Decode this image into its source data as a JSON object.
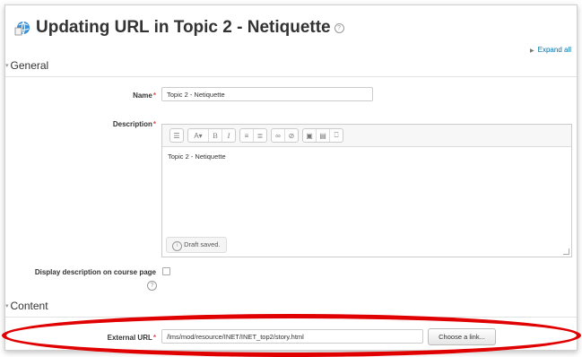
{
  "page": {
    "title": "Updating URL in Topic 2 - Netiquette",
    "expand_all": "Expand all"
  },
  "sections": {
    "general": "General",
    "content": "Content"
  },
  "form": {
    "name_label": "Name",
    "name_value": "Topic 2 - Netiquette",
    "description_label": "Description",
    "description_value": "Topic 2 - Netiquette",
    "draft_status": "Draft saved.",
    "display_description_label": "Display description on course page",
    "display_description_checked": false,
    "external_url_label": "External URL",
    "external_url_value": "/lms/mod/resource/INET/INET_top2/story.html",
    "choose_link_button": "Choose a link...",
    "required_marker": "*"
  },
  "toolbar": {
    "icons": [
      "format-icon",
      "font-style-icon",
      "bold-icon",
      "italic-icon",
      "unordered-list-icon",
      "ordered-list-icon",
      "link-icon",
      "unlink-icon",
      "image-icon",
      "media-icon",
      "manage-files-icon"
    ],
    "style_label": "A",
    "bold": "B",
    "italic": "I"
  },
  "colors": {
    "required": "#d9534f",
    "link": "#0070a8",
    "highlight": "#e00000"
  }
}
